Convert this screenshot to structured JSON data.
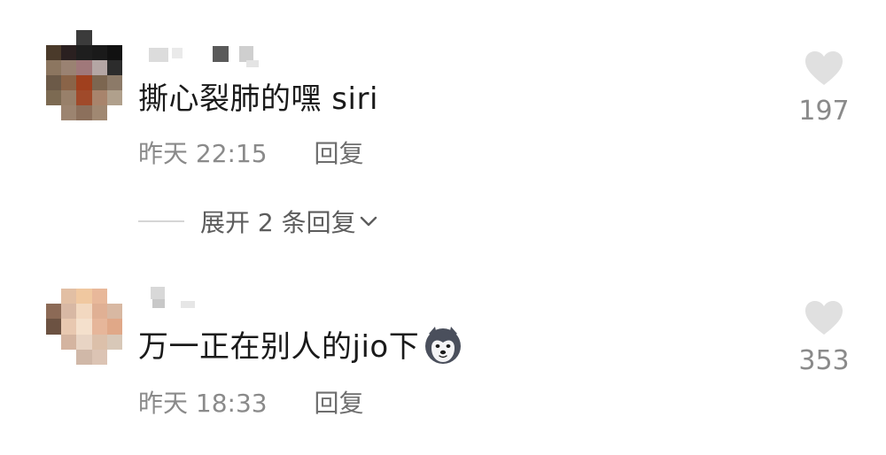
{
  "comments": [
    {
      "text": "撕心裂肺的嘿 siri",
      "time": "昨天 22:15",
      "reply_label": "回复",
      "likes": "197",
      "expand_label": "展开 2 条回复",
      "avatar_colors": [
        "#ffffff",
        "#ffffff",
        "#3b3b3b",
        "#ffffff",
        "#ffffff",
        "#4a3a2a",
        "#2a2020",
        "#1e1e1e",
        "#1a1a1a",
        "#111111",
        "#8c7660",
        "#9a8272",
        "#a0787a",
        "#b4a6a4",
        "#2c2c2c",
        "#6c5a48",
        "#8a6448",
        "#a0401e",
        "#7c6650",
        "#8c7a68",
        "#7c6a52",
        "#98806a",
        "#a04a2a",
        "#a8846c",
        "#b0a08c",
        "#ffffff",
        "#9c8470",
        "#8c705c",
        "#a08872",
        "#ffffff"
      ]
    },
    {
      "text": "万一正在别人的jio下",
      "time": "昨天 18:33",
      "reply_label": "回复",
      "likes": "353",
      "avatar_colors": [
        "#ffffff",
        "#e2bfa4",
        "#f0c8a0",
        "#e8b89a",
        "#ffffff",
        "#8c6a56",
        "#d8b8a4",
        "#f2d8c0",
        "#e0b094",
        "#d8b8a2",
        "#6c5242",
        "#e8c8b0",
        "#f4e0cc",
        "#e6b69a",
        "#e0a888",
        "#ffffff",
        "#d4b4a0",
        "#e8d4c4",
        "#dcc0aa",
        "#d8c8b8",
        "#ffffff",
        "#ffffff",
        "#d0b8a8",
        "#dcc4b4",
        "#ffffff"
      ]
    }
  ],
  "colors": {
    "text_primary": "#1a1a1a",
    "text_secondary": "#8a8a8a",
    "heart": "#e0e0e0"
  }
}
